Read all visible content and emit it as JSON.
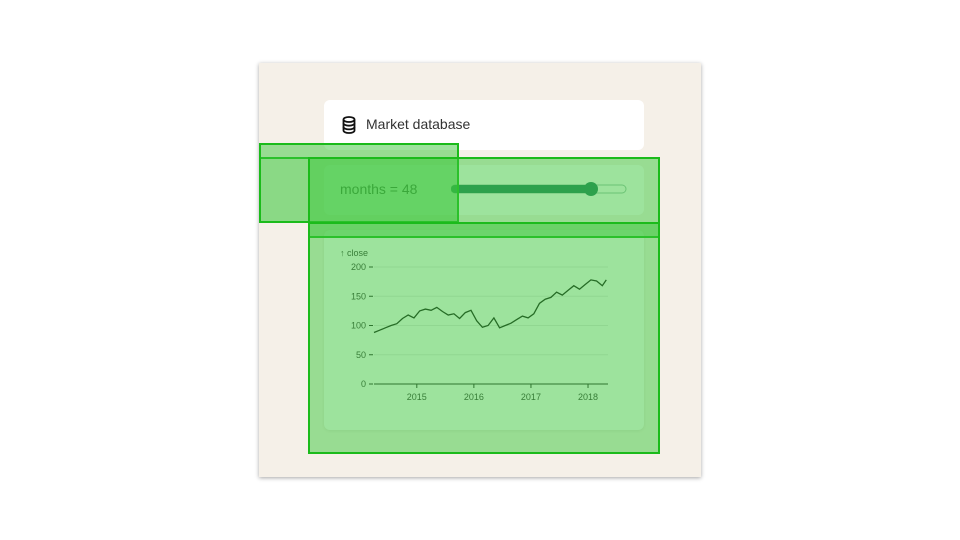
{
  "database": {
    "label": "Market database",
    "icon": "database-icon"
  },
  "control": {
    "label": "months = 48",
    "value": 48,
    "min": 0,
    "max": 60,
    "track_color": "#1f7a5c"
  },
  "chart_data": {
    "type": "line",
    "ylabel": "↑ close",
    "xlabel": "",
    "ylim": [
      0,
      200
    ],
    "yticks": [
      0,
      50,
      100,
      150,
      200
    ],
    "xticks": [
      "2015",
      "2016",
      "2017",
      "2018"
    ],
    "x": [
      2014.25,
      2014.35,
      2014.45,
      2014.55,
      2014.65,
      2014.75,
      2014.85,
      2014.95,
      2015.05,
      2015.15,
      2015.25,
      2015.35,
      2015.45,
      2015.55,
      2015.65,
      2015.75,
      2015.85,
      2015.95,
      2016.05,
      2016.15,
      2016.25,
      2016.35,
      2016.45,
      2016.55,
      2016.65,
      2016.75,
      2016.85,
      2016.95,
      2017.05,
      2017.15,
      2017.25,
      2017.35,
      2017.45,
      2017.55,
      2017.65,
      2017.75,
      2017.85,
      2017.95,
      2018.05,
      2018.15,
      2018.25,
      2018.32
    ],
    "y": [
      88,
      92,
      96,
      100,
      103,
      112,
      118,
      113,
      125,
      128,
      126,
      131,
      124,
      118,
      120,
      112,
      122,
      126,
      108,
      97,
      100,
      113,
      96,
      100,
      104,
      110,
      116,
      113,
      120,
      138,
      145,
      148,
      157,
      152,
      160,
      168,
      162,
      170,
      178,
      176,
      168,
      178
    ]
  }
}
